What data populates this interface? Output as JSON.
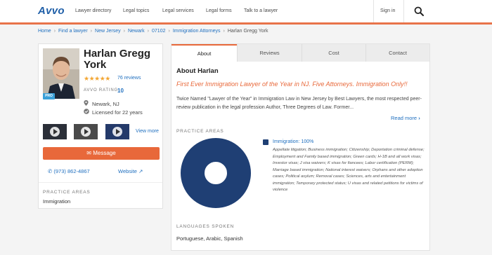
{
  "header": {
    "logo": "Avvo",
    "nav": [
      "Lawyer directory",
      "Legal topics",
      "Legal services",
      "Legal forms",
      "Talk to a lawyer"
    ],
    "signin": "Sign in",
    "accent_color": "#e8734a",
    "brand_color": "#1f5fa8"
  },
  "breadcrumb": [
    "Home",
    "Find a lawyer",
    "New Jersey",
    "Newark",
    "07102",
    "Immigration Attorneys"
  ],
  "breadcrumb_current": "Harlan Gregg York",
  "profile": {
    "name": "Harlan Gregg York",
    "pro_badge": "PRO",
    "stars": "★★★★★",
    "reviews": "76 reviews",
    "rating_label": "AVVO RATING",
    "rating_value": "10",
    "location": "Newark, NJ",
    "licensed": "Licensed for 22 years",
    "view_more": "View more",
    "message_label": "Message",
    "phone": "(973) 862-4867",
    "website": "Website",
    "practice_label": "PRACTICE AREAS",
    "practice_value": "Immigration"
  },
  "tabs": [
    "About",
    "Reviews",
    "Cost",
    "Contact"
  ],
  "about": {
    "title": "About Harlan",
    "headline": "First Ever Immigration Lawyer of the Year in NJ. Five Attorneys. Immigration Only!!",
    "bio": "Twice Named \"Lawyer of the Year\" in Immigration Law in New Jersey by Best Lawyers, the most respected peer-review publication in the legal profession Author, Three Degrees of Law. Former...",
    "read_more": "Read more",
    "practice_label": "PRACTICE AREAS",
    "legend_title": "Immigration: 100%",
    "legend_detail": "Appellate litigation; Business immigration; Citizenship; Deportation criminal defense; Employment and Family based immigration; Green cards; H-1B and all work visas; Investor visas; J visa waivers; K visas for fiancees; Labor certification (PERM); Marriage based immigration; National interest waivers; Orphans and other adoption cases; Political asylum; Removal cases; Sciences, arts and entertainment immigration; Temporary protected status; U visas and related petitions for victims of violence",
    "donut_color": "#1f3f74",
    "languages_label": "LANGUAGES SPOKEN",
    "languages": "Portuguese, Arabic, Spanish"
  },
  "chart_data": {
    "type": "pie",
    "categories": [
      "Immigration"
    ],
    "values": [
      100
    ]
  }
}
